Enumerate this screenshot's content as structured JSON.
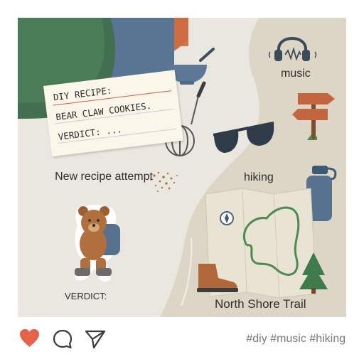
{
  "post": {
    "recipe_note": [
      "DIY RECIPE:",
      "BEAR CLAW COOKIES.",
      "VERDICT: ..."
    ],
    "labels": {
      "new_recipe": "New recipe attempt",
      "verdict": "VERDICT:",
      "music": "music",
      "hiking": "hiking",
      "trail": "North Shore Trail"
    },
    "colors": {
      "background_left": "#eae7e1",
      "background_right": "#ddd6c7",
      "map": "#e9e3d4",
      "trail_line": "#4d8a50",
      "like": "#e5634b"
    }
  },
  "actions": {
    "like_icon": "heart-icon",
    "comment_icon": "comment-icon",
    "share_icon": "send-icon",
    "hashtags": "#diy #music #hiking"
  }
}
